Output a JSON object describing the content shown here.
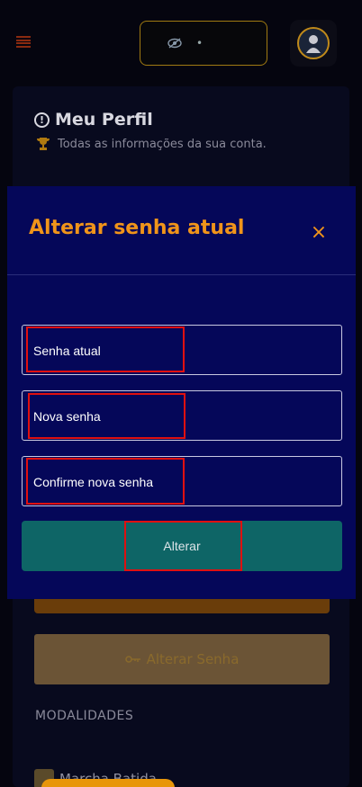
{
  "header": {
    "menu_icon": "hamburger-icon",
    "balance_visibility_icon": "eye-off-icon",
    "balance_value": "•",
    "avatar_icon": "user-avatar"
  },
  "profile": {
    "title": "Meu Perfil",
    "subtitle": "Todas as informações da sua conta.",
    "change_password_button": "Alterar Senha",
    "modalities_heading": "MODALIDADES",
    "modality_item": "Marcha Batida"
  },
  "modal": {
    "title": "Alterar senha atual",
    "close_label": "×",
    "fields": [
      {
        "label": "Senha atual",
        "value": ""
      },
      {
        "label": "Nova senha",
        "value": ""
      },
      {
        "label": "Confirme nova senha",
        "value": ""
      }
    ],
    "submit_label": "Alterar"
  },
  "colors": {
    "modal_bg": "#050759",
    "accent_orange": "#f0941a",
    "submit_bg": "#0e6566",
    "highlight_red": "#e01010"
  }
}
